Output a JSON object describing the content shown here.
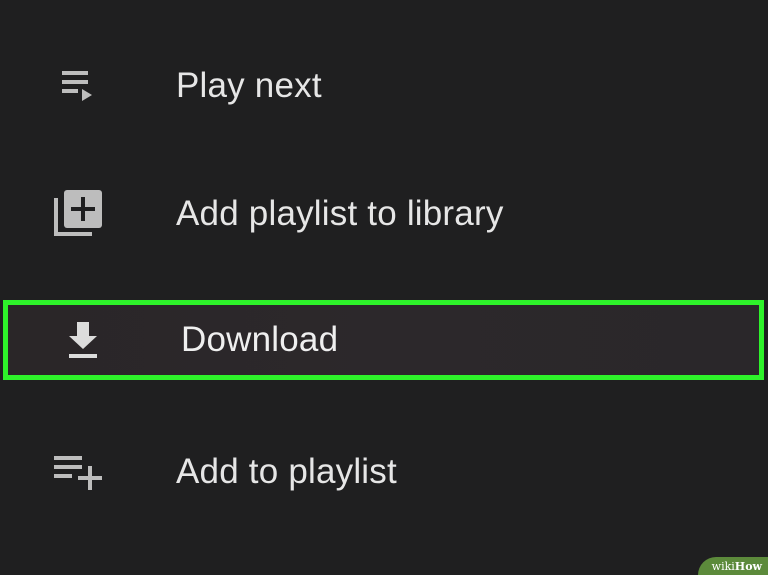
{
  "menu": {
    "items": [
      {
        "label": "Play next",
        "icon": "play-next-icon"
      },
      {
        "label": "Add playlist to library",
        "icon": "library-add-icon"
      },
      {
        "label": "Download",
        "icon": "download-icon",
        "highlighted": true
      },
      {
        "label": "Add to playlist",
        "icon": "playlist-add-icon"
      }
    ]
  },
  "colors": {
    "background": "#1f1f20",
    "text": "#e6e6e6",
    "icon": "#bdbdbd",
    "highlight_border": "#2ef22a"
  },
  "watermark": {
    "prefix": "wiki",
    "suffix": "How"
  }
}
